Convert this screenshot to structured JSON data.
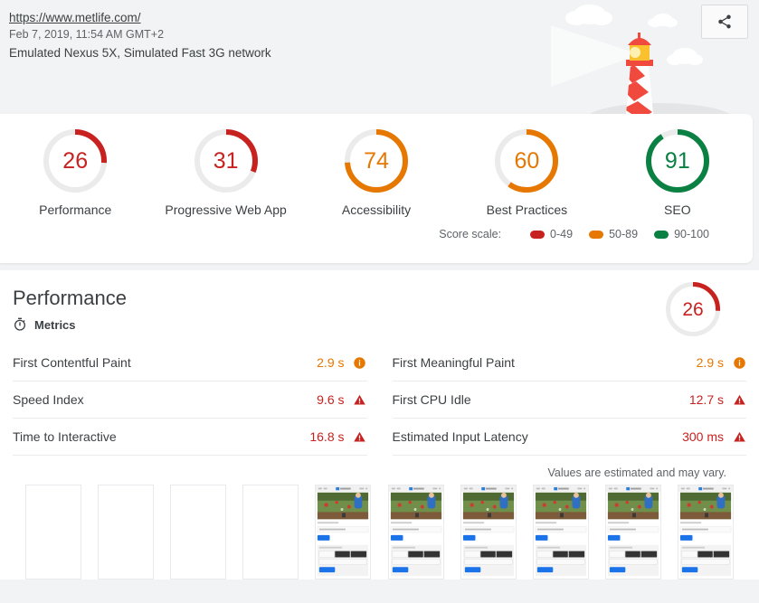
{
  "header": {
    "url": "https://www.metlife.com/",
    "timestamp": "Feb 7, 2019, 11:54 AM GMT+2",
    "environment": "Emulated Nexus 5X, Simulated Fast 3G network",
    "share_icon": "share-icon",
    "logo": "lighthouse-logo"
  },
  "scores": {
    "items": [
      {
        "label": "Performance",
        "value": "26",
        "score": 26,
        "color": "#c7221f"
      },
      {
        "label": "Progressive Web App",
        "value": "31",
        "score": 31,
        "color": "#c7221f"
      },
      {
        "label": "Accessibility",
        "value": "74",
        "score": 74,
        "color": "#e67700"
      },
      {
        "label": "Best Practices",
        "value": "60",
        "score": 60,
        "color": "#e67700"
      },
      {
        "label": "SEO",
        "value": "91",
        "score": 91,
        "color": "#0b8043"
      }
    ],
    "scale_label": "Score scale:",
    "scale": [
      {
        "range": "0-49",
        "color": "#c7221f"
      },
      {
        "range": "50-89",
        "color": "#e67700"
      },
      {
        "range": "90-100",
        "color": "#0b8043"
      }
    ]
  },
  "performance": {
    "title": "Performance",
    "gauge": {
      "value": "26",
      "score": 26,
      "color": "#c7221f"
    },
    "metrics_heading": "Metrics",
    "metrics_icon": "stopwatch-icon",
    "metrics_left": [
      {
        "name": "First Contentful Paint",
        "value": "2.9 s",
        "status": "average",
        "icon": "info-circle-icon"
      },
      {
        "name": "Speed Index",
        "value": "9.6 s",
        "status": "fail",
        "icon": "warning-triangle-icon"
      },
      {
        "name": "Time to Interactive",
        "value": "16.8 s",
        "status": "fail",
        "icon": "warning-triangle-icon"
      }
    ],
    "metrics_right": [
      {
        "name": "First Meaningful Paint",
        "value": "2.9 s",
        "status": "average",
        "icon": "info-circle-icon"
      },
      {
        "name": "First CPU Idle",
        "value": "12.7 s",
        "status": "fail",
        "icon": "warning-triangle-icon"
      },
      {
        "name": "Estimated Input Latency",
        "value": "300 ms",
        "status": "fail",
        "icon": "warning-triangle-icon"
      }
    ],
    "estimate_note": "Values are estimated and may vary.",
    "filmstrip": [
      {
        "rendered": false
      },
      {
        "rendered": false
      },
      {
        "rendered": false
      },
      {
        "rendered": false
      },
      {
        "rendered": true
      },
      {
        "rendered": true
      },
      {
        "rendered": true
      },
      {
        "rendered": true
      },
      {
        "rendered": true
      },
      {
        "rendered": true
      }
    ]
  }
}
